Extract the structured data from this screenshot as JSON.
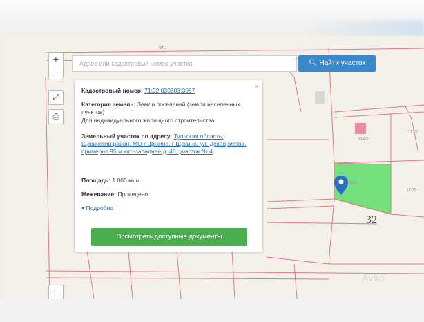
{
  "search": {
    "placeholder": "Адрес или кадастровый номер участка",
    "button_label": "Найти участок"
  },
  "map_controls": {
    "zoom_in": "+",
    "zoom_out": "−",
    "top_label": "ул.",
    "corner_marker": "L"
  },
  "parcel_info": {
    "cadastral_label": "Кадастровый номер:",
    "cadastral_value": "71:22:030303:3067",
    "category_label": "Категория земель:",
    "category_value": "Земли поселений (земли населенных пунктов)",
    "use_value": "Для индивидуального жилищного строительства",
    "address_label": "Земельный участок по адресу:",
    "address_value": "Тульская область, Щекинский район, МО г Щекино, г Щекино, ул. Декабристов, примерно 95 м юго-западнее д. 46, участок № 4",
    "area_label": "Площадь:",
    "area_value": "1 000 кв.м.",
    "survey_label": "Межевание:",
    "survey_value": "Проведено",
    "more_toggle": "▾ Подробно",
    "docs_button": "Посмотреть доступные документы"
  },
  "map_labels": {
    "block_number": "32",
    "parcel_a": "1140",
    "parcel_b": "1125",
    "parcel_c": "1140",
    "parcel_d": "1105"
  },
  "watermark": "Avito",
  "colors": {
    "highlight_parcel": "#74e07c",
    "search_button": "#3a87c9",
    "docs_button": "#4aae4f",
    "parcel_lines": "#e07a84",
    "marker": "#2a6fc4"
  }
}
